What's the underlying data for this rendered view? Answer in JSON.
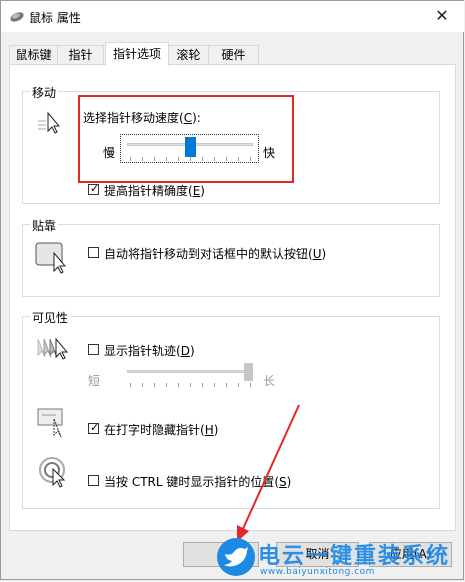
{
  "window": {
    "title": "鼠标 属性",
    "close_glyph": "✕"
  },
  "tabs": [
    {
      "label": "鼠标键"
    },
    {
      "label": "指针"
    },
    {
      "label": "指针选项"
    },
    {
      "label": "滚轮"
    },
    {
      "label": "硬件"
    }
  ],
  "motion": {
    "group_label": "移动",
    "speed_label": "选择指针移动速度(",
    "speed_accel": "C",
    "speed_label_end": "):",
    "slow_label": "慢",
    "fast_label": "快",
    "speed_level": 0.5,
    "precision_checked": true,
    "precision_label": "提高指针精确度(",
    "precision_accel": "E",
    "precision_label_end": ")"
  },
  "snap": {
    "group_label": "贴靠",
    "checked": false,
    "label": "自动将指针移动到对话框中的默认按钮(",
    "accel": "U",
    "label_end": ")"
  },
  "visibility": {
    "group_label": "可见性",
    "trails_checked": false,
    "trails_label": "显示指针轨迹(",
    "trails_accel": "D",
    "trails_label_end": ")",
    "short_label": "短",
    "long_label": "长",
    "trails_level": 1.0,
    "hide_checked": true,
    "hide_label": "在打字时隐藏指针(",
    "hide_accel": "H",
    "hide_label_end": ")",
    "ctrl_checked": false,
    "ctrl_label": "当按 CTRL 键时显示指针的位置(",
    "ctrl_accel": "S",
    "ctrl_label_end": ")"
  },
  "buttons": {
    "cancel_label": "取消",
    "apply_label": "应用(A)"
  },
  "watermark": {
    "text": "电云一键重装系统",
    "url": "www.baiyunxitong.com"
  },
  "colors": {
    "accent": "#0078d7",
    "highlight_box": "#e22727",
    "annotation_arrow": "#e22727"
  }
}
